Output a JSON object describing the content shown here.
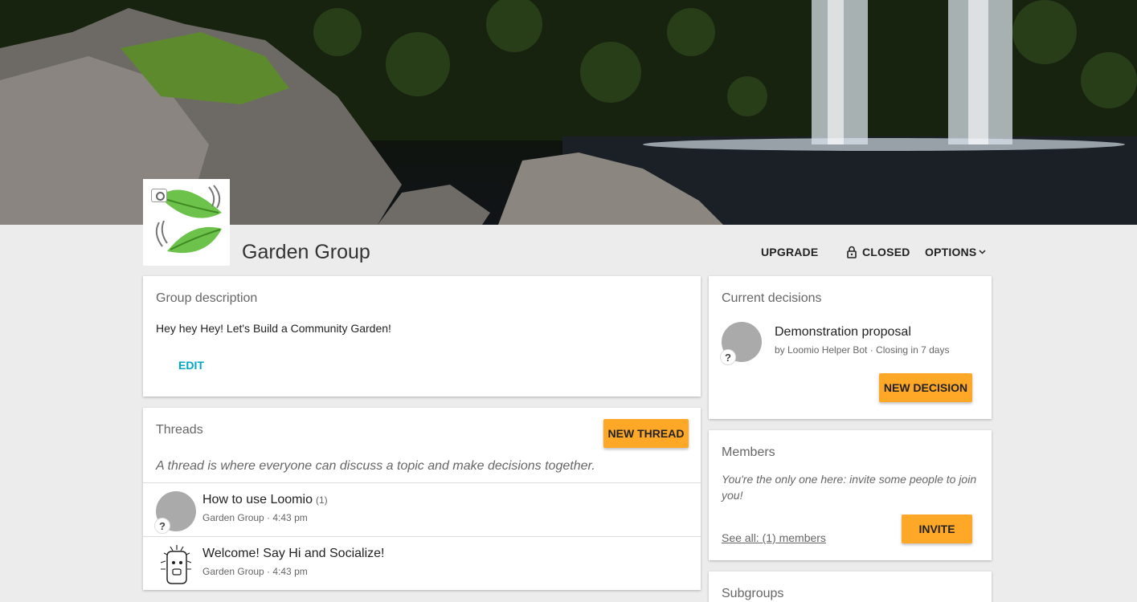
{
  "group": {
    "name": "Garden Group"
  },
  "header_actions": {
    "upgrade": "UPGRADE",
    "closed": "CLOSED",
    "options": "OPTIONS"
  },
  "description_card": {
    "title": "Group description",
    "text": "Hey hey Hey! Let's Build a Community Garden!",
    "edit_label": "EDIT"
  },
  "threads_card": {
    "title": "Threads",
    "new_thread_label": "NEW THREAD",
    "help_text": "A thread is where everyone can discuss a topic and make decisions together.",
    "threads": [
      {
        "title": "How to use Loomio",
        "count": "(1)",
        "meta": "Garden Group · 4:43 pm",
        "avatar": "unknown-avatar",
        "badge": "?"
      },
      {
        "title": "Welcome! Say Hi and Socialize!",
        "meta": "Garden Group · 4:43 pm",
        "avatar": "bot-avatar"
      }
    ]
  },
  "decisions_card": {
    "title": "Current decisions",
    "proposal_title": "Demonstration proposal",
    "proposal_meta": "by Loomio Helper Bot · Closing in 7 days",
    "badge": "?",
    "new_decision_label": "NEW DECISION"
  },
  "members_card": {
    "title": "Members",
    "help_text": "You're the only one here: invite some people to join you!",
    "see_all": "See all: (1) members",
    "invite_label": "INVITE"
  },
  "subgroups_card": {
    "title": "Subgroups"
  },
  "colors": {
    "accent_orange": "#ffa726",
    "link_teal": "#00a7c4",
    "page_bg": "#ececec"
  }
}
